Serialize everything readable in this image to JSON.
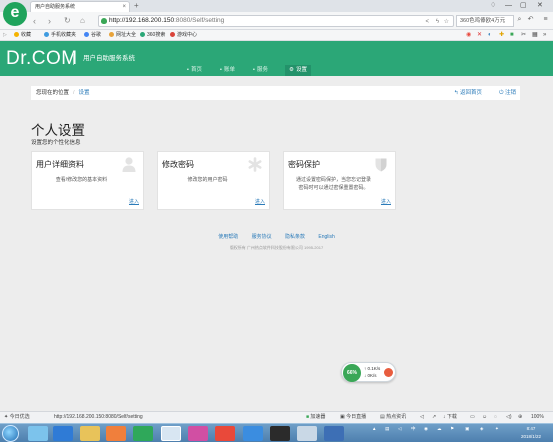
{
  "browser": {
    "tab_title": "用户自助服务系统",
    "tab_close": "×",
    "new_tab": "+",
    "url_host": "http://192.168.200.150",
    "url_rest": ":8080/Self/setting",
    "search_text": "360色鸡傣欧4万元",
    "icons": {
      "back": "chevron-left-icon",
      "forward": "chevron-right-icon",
      "refresh": "refresh-icon",
      "home": "home-icon",
      "star": "star-icon",
      "share": "share-icon",
      "lightning": "lightning-icon",
      "menu": "menu-icon"
    }
  },
  "bookmarks": [
    {
      "label": "收藏",
      "color": "#f5b300"
    },
    {
      "label": "手机收藏夹",
      "color": "#3f9be0"
    },
    {
      "label": "谷歌",
      "color": "#4285f4"
    },
    {
      "label": "网址大全",
      "color": "#e8a33a"
    },
    {
      "label": "360搜索",
      "color": "#2ba777"
    },
    {
      "label": "游戏中心",
      "color": "#d9443a"
    }
  ],
  "app": {
    "brand": "Dr.COM",
    "subtitle": "用户自助服务系统",
    "nav": [
      {
        "icon": "▪",
        "label": "首页"
      },
      {
        "icon": "▪",
        "label": "账单"
      },
      {
        "icon": "▪",
        "label": "服务"
      },
      {
        "icon": "⚙",
        "label": "设置"
      }
    ]
  },
  "breadcrumb": {
    "prefix": "您现在的位置",
    "current": "设置",
    "back_home": "返回首页",
    "logout": "注销"
  },
  "page": {
    "title": "个人设置",
    "subtitle": "设置您的个性化信息"
  },
  "cards": [
    {
      "title": "用户详细资料",
      "desc": "查看/修改您的基本资料",
      "link": "进入",
      "icon": "user-icon"
    },
    {
      "title": "修改密码",
      "desc": "修改您的用户密码",
      "link": "进入",
      "icon": "asterisk-icon"
    },
    {
      "title": "密码保护",
      "desc": "通过设置密码保护，当您忘记登录密码时可以通过密保重置密码。",
      "link": "进入",
      "icon": "shield-icon"
    }
  ],
  "footer": {
    "links": [
      "使用帮助",
      "服务协议",
      "隐私条款",
      "English"
    ],
    "copyright": "版权所有 广州热点软件科技股份有限公司 1995-2017"
  },
  "widget": {
    "percent": "66%",
    "up": "0.1K/s",
    "down": "0K/s"
  },
  "statusbar": {
    "today": "今日优选",
    "link_url": "http://192.168.200.150:8080/Self/setting",
    "accelerator": "加速器",
    "live": "今日直播",
    "hot": "热点资讯",
    "download": "下载",
    "zoom": "100%"
  },
  "taskbar": {
    "time": "8:47",
    "date": "2018/1/22"
  }
}
